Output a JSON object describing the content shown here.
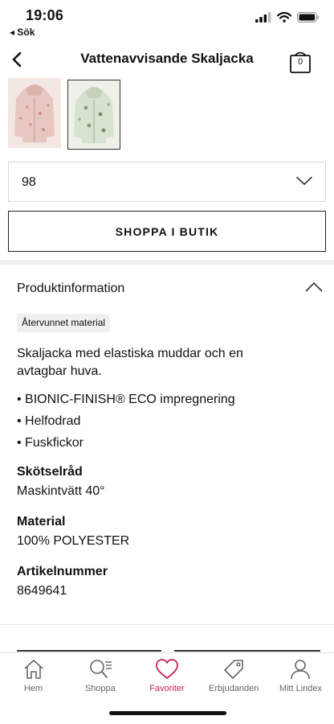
{
  "status": {
    "time": "19:06",
    "back_label": "◂ Sök",
    "icons": [
      "cellular-signal-icon",
      "wifi-icon",
      "battery-icon"
    ]
  },
  "nav": {
    "title": "Vattenavvisande Skaljacka",
    "back_icon": "chevron-left-icon",
    "cart_icon": "shopping-bag-icon",
    "cart_count": "0"
  },
  "gallery": {
    "thumbnails": [
      {
        "variant": "pink floral jacket",
        "selected": false
      },
      {
        "variant": "green floral jacket",
        "selected": true
      }
    ]
  },
  "size_select": {
    "value": "98",
    "icon": "chevron-down-icon"
  },
  "shop_button": {
    "label": "SHOPPA I BUTIK"
  },
  "product_info": {
    "title": "Produktinformation",
    "expanded": true,
    "badge": "Återvunnet material",
    "description": "Skaljacka med elastiska muddar och en avtagbar huva.",
    "bullets": [
      "• BIONIC-FINISH® ECO impregnering",
      "• Helfodrad",
      "• Fuskfickor"
    ],
    "care_heading": "Skötselråd",
    "care_value": "Maskintvätt 40°",
    "material_heading": "Material",
    "material_value": "100% POLYESTER",
    "article_heading": "Artikelnummer",
    "article_value": "8649641"
  },
  "tabbar": {
    "tabs": [
      {
        "label": "Hem",
        "icon": "home-icon",
        "active": false
      },
      {
        "label": "Shoppa",
        "icon": "search-list-icon",
        "active": false
      },
      {
        "label": "Favoriter",
        "icon": "heart-icon",
        "active": true
      },
      {
        "label": "Erbjudanden",
        "icon": "price-tag-icon",
        "active": false
      },
      {
        "label": "Mitt Lindex",
        "icon": "user-icon",
        "active": false
      }
    ]
  },
  "colors": {
    "accent": "#c8205a",
    "text": "#111111",
    "muted": "#666666",
    "divider": "#f0f0f0"
  }
}
